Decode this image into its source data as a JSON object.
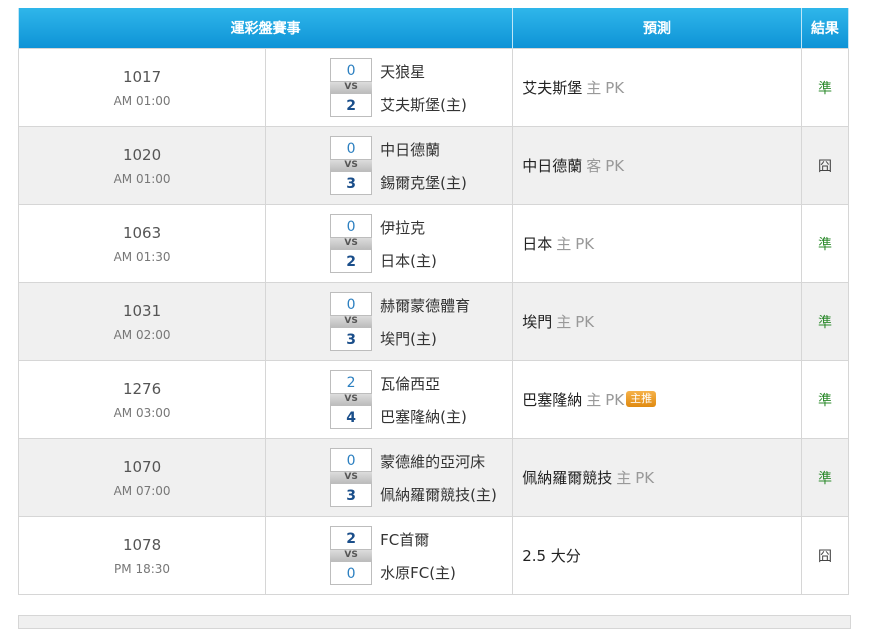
{
  "header": {
    "match_col": "運彩盤賽事",
    "pred_col": "預測",
    "result_col": "結果"
  },
  "rows": [
    {
      "no": "1017",
      "time": "AM 01:00",
      "score1": "0",
      "score2": "2",
      "win": 2,
      "team1": "天狼星",
      "team2": "艾夫斯堡(主)",
      "pred_team": "艾夫斯堡",
      "pred_side": "主",
      "pred_pk": "PK",
      "badge": "",
      "result": "準",
      "hit": true
    },
    {
      "no": "1020",
      "time": "AM 01:00",
      "score1": "0",
      "score2": "3",
      "win": 2,
      "team1": "中日德蘭",
      "team2": "錫爾克堡(主)",
      "pred_team": "中日德蘭",
      "pred_side": "客",
      "pred_pk": "PK",
      "badge": "",
      "result": "囧",
      "hit": false
    },
    {
      "no": "1063",
      "time": "AM 01:30",
      "score1": "0",
      "score2": "2",
      "win": 2,
      "team1": "伊拉克",
      "team2": "日本(主)",
      "pred_team": "日本",
      "pred_side": "主",
      "pred_pk": "PK",
      "badge": "",
      "result": "準",
      "hit": true
    },
    {
      "no": "1031",
      "time": "AM 02:00",
      "score1": "0",
      "score2": "3",
      "win": 2,
      "team1": "赫爾蒙德體育",
      "team2": "埃門(主)",
      "pred_team": "埃門",
      "pred_side": "主",
      "pred_pk": "PK",
      "badge": "",
      "result": "準",
      "hit": true
    },
    {
      "no": "1276",
      "time": "AM 03:00",
      "score1": "2",
      "score2": "4",
      "win": 2,
      "team1": "瓦倫西亞",
      "team2": "巴塞隆納(主)",
      "pred_team": "巴塞隆納",
      "pred_side": "主",
      "pred_pk": "PK",
      "badge": "主推",
      "result": "準",
      "hit": true
    },
    {
      "no": "1070",
      "time": "AM 07:00",
      "score1": "0",
      "score2": "3",
      "win": 2,
      "team1": "蒙德維的亞河床",
      "team2": "佩納羅爾競技(主)",
      "pred_team": "佩納羅爾競技",
      "pred_side": "主",
      "pred_pk": "PK",
      "badge": "",
      "result": "準",
      "hit": true
    },
    {
      "no": "1078",
      "time": "PM 18:30",
      "score1": "2",
      "score2": "0",
      "win": 1,
      "team1": "FC首爾",
      "team2": "水原FC(主)",
      "pred_team": "2.5 大分",
      "pred_side": "",
      "pred_pk": "",
      "badge": "",
      "result": "囧",
      "hit": false
    }
  ],
  "colors": {
    "header": "#1aa3e0",
    "hit": "#2e8b2e",
    "badge": "#f0a030"
  },
  "icons": {
    "vs": "vs-divider"
  }
}
